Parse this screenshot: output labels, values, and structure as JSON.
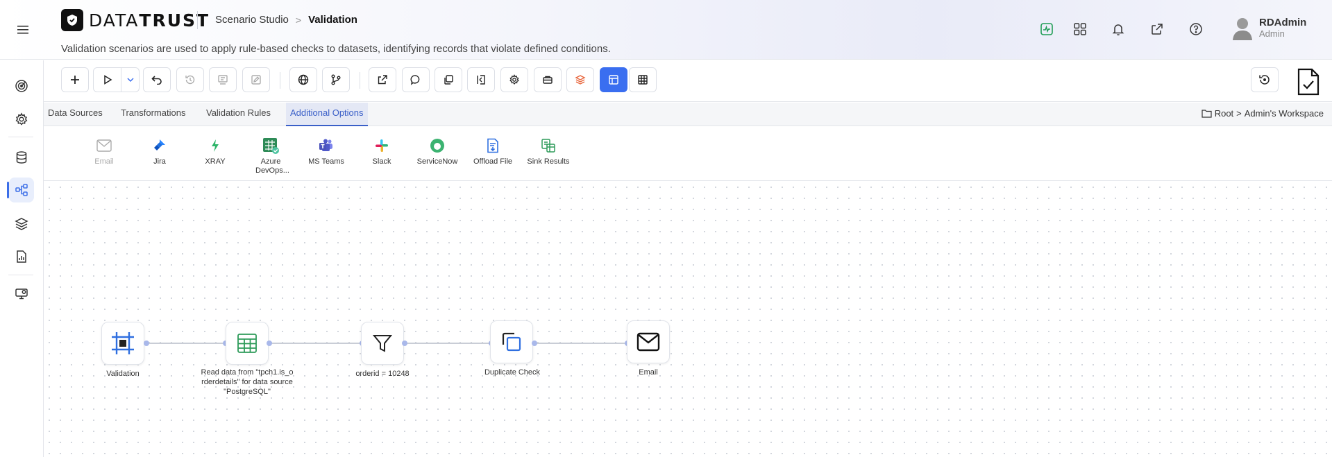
{
  "brand": {
    "name_bold": "DATA",
    "name_light": "TRUST"
  },
  "breadcrumb": {
    "parent": "Scenario Studio",
    "separator": ">",
    "current": "Validation"
  },
  "subtitle": "Validation scenarios are used to apply rule-based checks to datasets, identifying records that violate defined conditions.",
  "user": {
    "name": "RDAdmin",
    "role": "Admin"
  },
  "header_icons": [
    "activity-icon",
    "apps-grid-icon",
    "bell-icon",
    "external-link-icon",
    "help-icon"
  ],
  "sidebar_icons": [
    "target-icon",
    "settings-icon",
    "database-icon",
    "workflow-icon",
    "layers-icon",
    "report-icon",
    "monitor-icon"
  ],
  "tabs": [
    {
      "label": "Data Sources"
    },
    {
      "label": "Transformations"
    },
    {
      "label": "Validation Rules"
    },
    {
      "label": "Additional Options",
      "active": true
    }
  ],
  "path": {
    "root": "Root",
    "separator": ">",
    "workspace": "Admin's Workspace"
  },
  "integrations": [
    {
      "label": "Email",
      "disabled": true
    },
    {
      "label": "Jira"
    },
    {
      "label": "XRAY"
    },
    {
      "label": "Azure DevOps..."
    },
    {
      "label": "MS Teams"
    },
    {
      "label": "Slack"
    },
    {
      "label": "ServiceNow"
    },
    {
      "label": "Offload File"
    },
    {
      "label": "Sink Results"
    }
  ],
  "flow": {
    "nodes": [
      {
        "id": "validation",
        "label": "Validation",
        "icon": "frame-icon"
      },
      {
        "id": "read",
        "label": "Read data from \"tpch1.is_orderdetails\" for data source \"PostgreSQL\"",
        "icon": "table-icon"
      },
      {
        "id": "filter",
        "label": "orderid = 10248",
        "icon": "filter-icon"
      },
      {
        "id": "dup",
        "label": "Duplicate Check",
        "icon": "copy-icon"
      },
      {
        "id": "email",
        "label": "Email",
        "icon": "mail-icon"
      }
    ]
  },
  "colors": {
    "accent": "#3a6ef0",
    "active_tab": "#3a5fc8",
    "port": "#a9b8ea"
  }
}
